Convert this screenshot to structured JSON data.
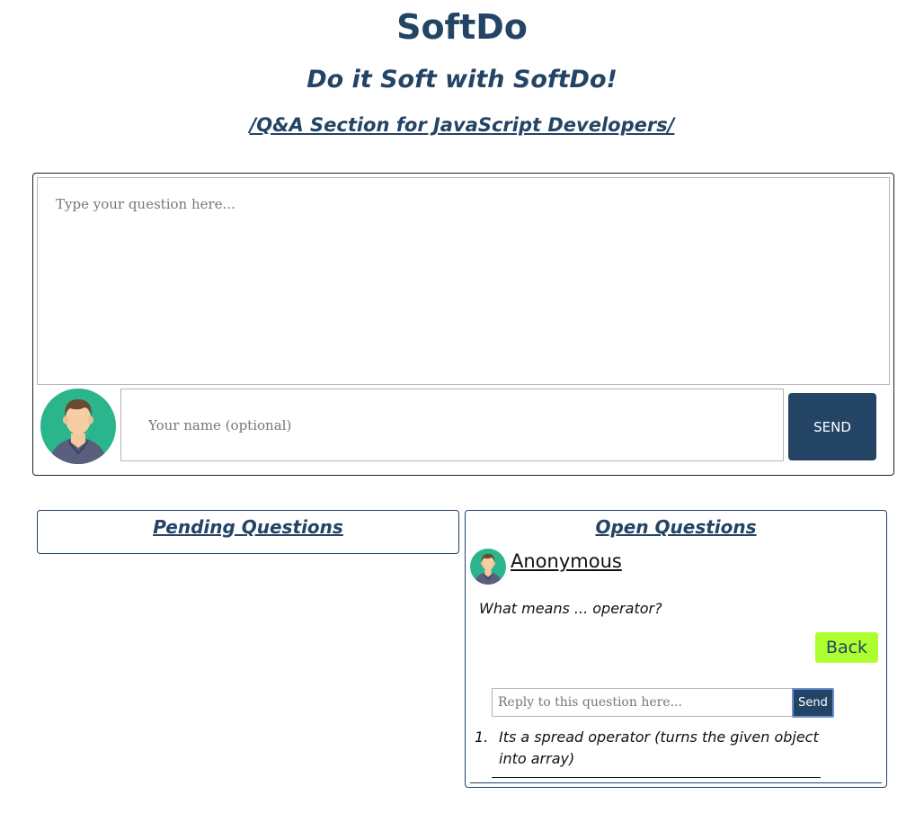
{
  "header": {
    "title": "SoftDo",
    "subtitle": "Do it Soft with SoftDo!",
    "section_link": "/Q&A Section for JavaScript Developers/"
  },
  "ask_form": {
    "question_placeholder": "Type your question here...",
    "name_placeholder": "Your name (optional)",
    "send_label": "SEND"
  },
  "pending": {
    "title": "Pending Questions"
  },
  "open": {
    "title": "Open Questions",
    "question": {
      "author": "Anonymous",
      "text": "What means ... operator?"
    },
    "back_label": "Back",
    "reply_placeholder": "Reply to this question here...",
    "reply_send_label": "Send",
    "answers": [
      {
        "number": "1.",
        "text": "Its a spread operator (turns the given object into array)"
      }
    ]
  },
  "colors": {
    "brand": "#234465",
    "back_button": "#adff2f",
    "avatar_bg": "#2bb58c"
  }
}
